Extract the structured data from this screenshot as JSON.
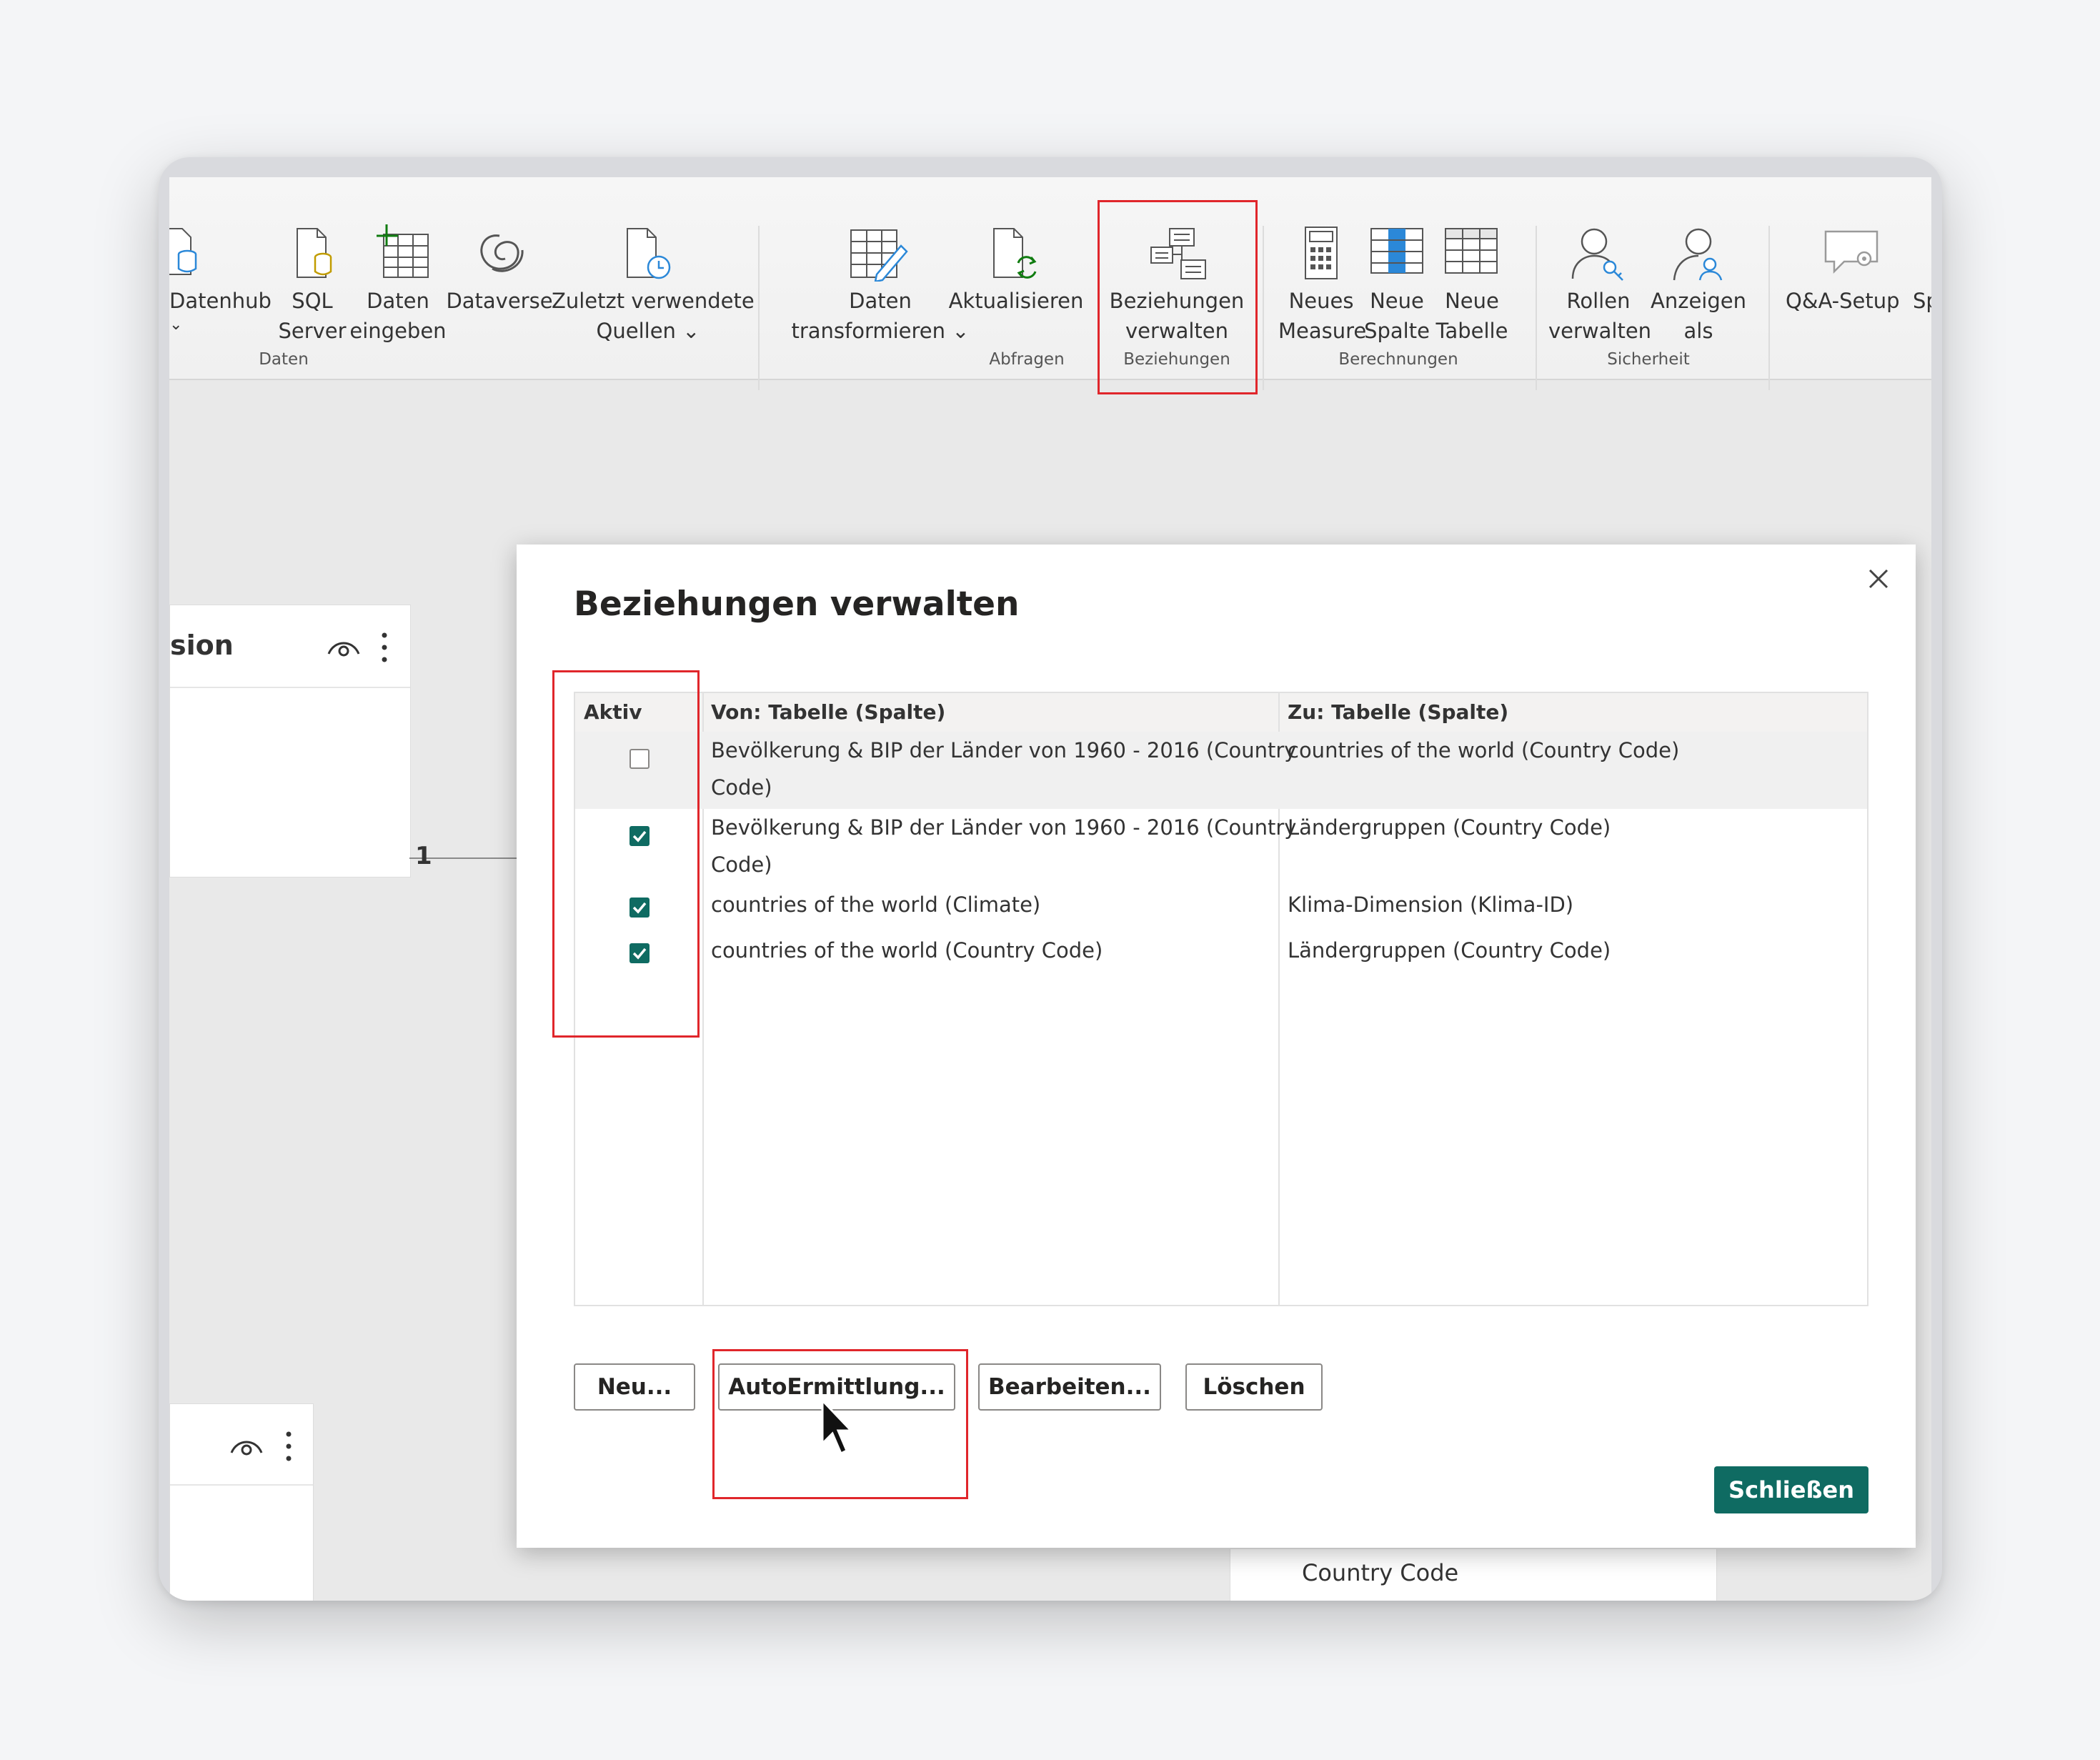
{
  "ribbon": {
    "groups": {
      "daten": {
        "label": "Daten",
        "items": {
          "datenhub": "Datenhub",
          "sql_line1": "SQL",
          "sql_line2": "Server",
          "daten_eingeben_line1": "Daten",
          "daten_eingeben_line2": "eingeben",
          "dataverse": "Dataverse",
          "zuletzt_line1": "Zuletzt verwendete",
          "zuletzt_line2": "Quellen ⌄"
        }
      },
      "abfragen": {
        "label": "Abfragen",
        "items": {
          "transform_line1": "Daten",
          "transform_line2": "transformieren ⌄",
          "aktualisieren": "Aktualisieren"
        }
      },
      "beziehungen": {
        "label": "Beziehungen",
        "items": {
          "line1": "Beziehungen",
          "line2": "verwalten"
        }
      },
      "berechnungen": {
        "label": "Berechnungen",
        "items": {
          "measure_line1": "Neues",
          "measure_line2": "Measure",
          "spalte_line1": "Neue",
          "spalte_line2": "Spalte",
          "tabelle_line1": "Neue",
          "tabelle_line2": "Tabelle"
        }
      },
      "sicherheit": {
        "label": "Sicherheit",
        "items": {
          "rollen_line1": "Rollen",
          "rollen_line2": "verwalten",
          "anzeigen_line1": "Anzeigen",
          "anzeigen_line2": "als"
        }
      },
      "qa": {
        "items": {
          "qa_setup": "Q&A-Setup",
          "sp": "Sp"
        }
      }
    }
  },
  "canvas": {
    "card1_title": "sion",
    "relation_label": "1",
    "bottom_field": "Country Code"
  },
  "dialog": {
    "title": "Beziehungen verwalten",
    "columns": [
      "Aktiv",
      "Von: Tabelle (Spalte)",
      "Zu: Tabelle (Spalte)"
    ],
    "rows": [
      {
        "active": false,
        "from_line1": "Bevölkerung & BIP der Länder von 1960 - 2016 (Country",
        "from_line2": "Code)",
        "to": "countries of the world (Country Code)"
      },
      {
        "active": true,
        "from_line1": "Bevölkerung & BIP der Länder von 1960 - 2016 (Country",
        "from_line2": "Code)",
        "to": "Ländergruppen (Country Code)"
      },
      {
        "active": true,
        "from_line1": "countries of the world (Climate)",
        "from_line2": "",
        "to": "Klima-Dimension (Klima-ID)"
      },
      {
        "active": true,
        "from_line1": "countries of the world (Country Code)",
        "from_line2": "",
        "to": "Ländergruppen (Country Code)"
      }
    ],
    "buttons": {
      "neu": "Neu...",
      "auto": "AutoErmittlung...",
      "bearbeiten": "Bearbeiten...",
      "loeschen": "Löschen",
      "schliessen": "Schließen"
    }
  },
  "colors": {
    "accent": "#0f6b62",
    "highlight": "#e0262b"
  }
}
